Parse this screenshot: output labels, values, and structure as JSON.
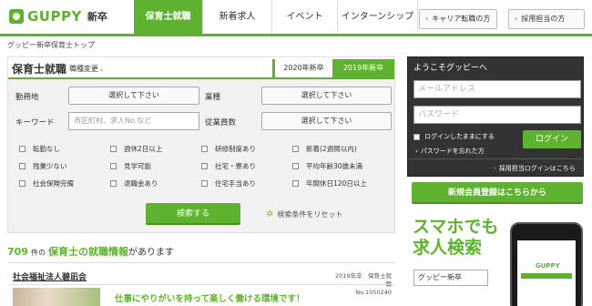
{
  "header": {
    "logo_text": "GUPPY",
    "logo_sub": "新卒",
    "nav": [
      {
        "label": "保育士就職",
        "active": true
      },
      {
        "label": "新着求人",
        "active": false
      },
      {
        "label": "イベント",
        "active": false
      },
      {
        "label": "インターンシップ",
        "active": false
      }
    ],
    "career_change_label": "キャリア転職の方",
    "recruiter_label": "採用担当の方"
  },
  "breadcrumb": "グッピー新卒保育士トップ",
  "search": {
    "title": "保育士就職",
    "change_label": "職種変更",
    "year_tabs": [
      {
        "label": "2020年新卒",
        "active": false
      },
      {
        "label": "2019年新卒",
        "active": true
      }
    ],
    "fields": {
      "location_label": "勤務地",
      "location_value": "選択して下さい",
      "industry_label": "業種",
      "industry_value": "選択して下さい",
      "keyword_label": "キーワード",
      "keyword_placeholder": "市区町村、求人No.など",
      "employees_label": "従業員数",
      "employees_value": "選択して下さい"
    },
    "checkboxes": [
      [
        "転勤なし",
        "週休2日以上",
        "研修制度あり",
        "新着(2週間以内)"
      ],
      [
        "残業少ない",
        "見学可能",
        "社宅・寮あり",
        "平均年齢30歳未満"
      ],
      [
        "社会保険完備",
        "退職金あり",
        "住宅手当あり",
        "年間休日120日以上"
      ]
    ],
    "search_button": "検索する",
    "reset_label": "検索条件をリセット"
  },
  "results": {
    "count": "709",
    "count_suffix": "件の",
    "highlight": "保育士の就職情報",
    "tail": "があります",
    "first_job": {
      "org": "社会福祉法人碧凪会",
      "year_type": "2019年卒　保育士就職",
      "number": "No.1050240",
      "catch": "仕事にやりがいを持って楽しく働ける環境です！"
    }
  },
  "login": {
    "title": "ようこそグッピーへ",
    "email_placeholder": "メールアドレス",
    "password_placeholder": "パスワード",
    "keep_label": "ログインしたままにする",
    "forgot_label": "パスワードを忘れた方",
    "login_button": "ログイン",
    "employer_login": "採用担当ログインはこちら"
  },
  "register_button": "新規会員登録はこちらから",
  "smartphone": {
    "copy_line1": "スマホでも",
    "copy_line2": "求人検索",
    "input_value": "グッピー新卒",
    "screen_logo": "GUPPY"
  },
  "colors": {
    "brand_green": "#5fb22f",
    "dark_panel": "#333333"
  }
}
